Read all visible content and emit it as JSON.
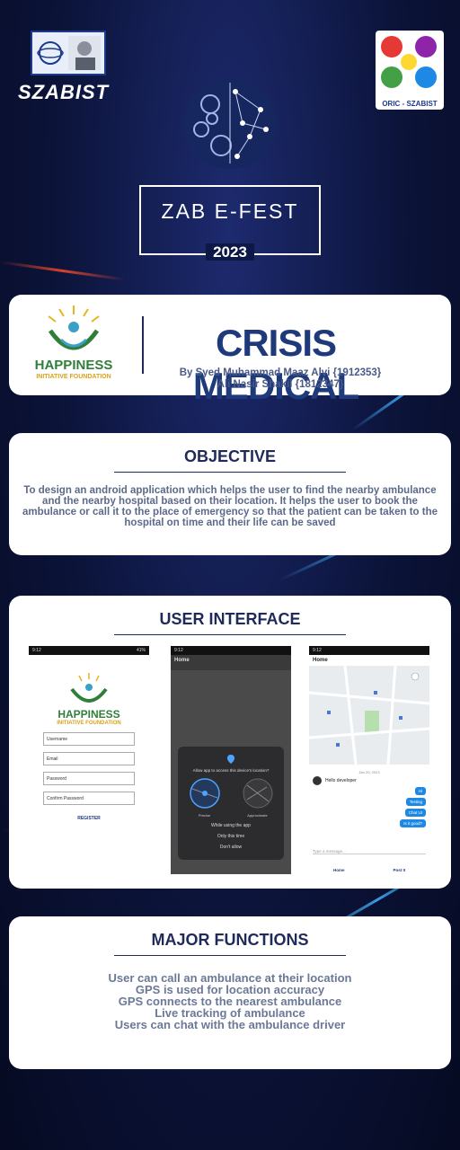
{
  "header": {
    "left_logo_text": "SZABIST",
    "right_logo_caption": "ORIC - SZABIST",
    "fest_title": "ZAB E-FEST",
    "fest_year": "2023"
  },
  "project": {
    "partner_name": "HAPPINESS",
    "partner_subtitle": "INITIATIVE FOUNDATION",
    "title": "CRISIS MEDICAL",
    "authors_line1": "By Syed Muhammad Maaz Alvi  {1912353}",
    "authors_line2": "Ali Nasir Shakil {1812347}"
  },
  "objective": {
    "heading": "OBJECTIVE",
    "text": "To design an android application which helps the user to find the nearby ambulance and the nearby hospital based on their location. It helps the user to book the ambulance or call it to the place of emergency so that the patient can be taken to the hospital on time and their life can be saved"
  },
  "user_interface": {
    "heading": "USER INTERFACE",
    "screen1": {
      "status": "9:12",
      "status_right": "41%",
      "brand": "HAPPINESS",
      "brand_sub": "INITIATIVE FOUNDATION",
      "fields": [
        "Username",
        "Email",
        "Password",
        "Confirm Password"
      ],
      "register": "REGISTER"
    },
    "screen2": {
      "status": "9:12",
      "title": "Home",
      "dialog_title": "Allow app to access this device's location?",
      "precise": "Precise",
      "approximate": "Approximate",
      "options": [
        "While using the app",
        "Only this time",
        "Don't allow"
      ]
    },
    "screen3": {
      "status": "9:12",
      "title": "Home",
      "date": "Jan 20, 2023",
      "incoming": "Hello developer",
      "outgoing": [
        "Hi",
        "Testing",
        "Chat UI",
        "Is it good?"
      ],
      "input_placeholder": "Type a message...",
      "nav": [
        "Home",
        "Post II"
      ]
    }
  },
  "functions": {
    "heading": "MAJOR FUNCTIONS",
    "items": [
      "User can call an ambulance at their location",
      "GPS is used for location accuracy",
      "GPS connects to the nearest ambulance",
      "Live tracking of ambulance",
      "Users can chat with the ambulance driver"
    ]
  },
  "colors": {
    "navy": "#1f2a5a",
    "title_blue": "#1f3a7a",
    "green": "#2f7f3a",
    "accent_red": "#ff4a2a",
    "accent_blue": "#3fb2ff"
  }
}
